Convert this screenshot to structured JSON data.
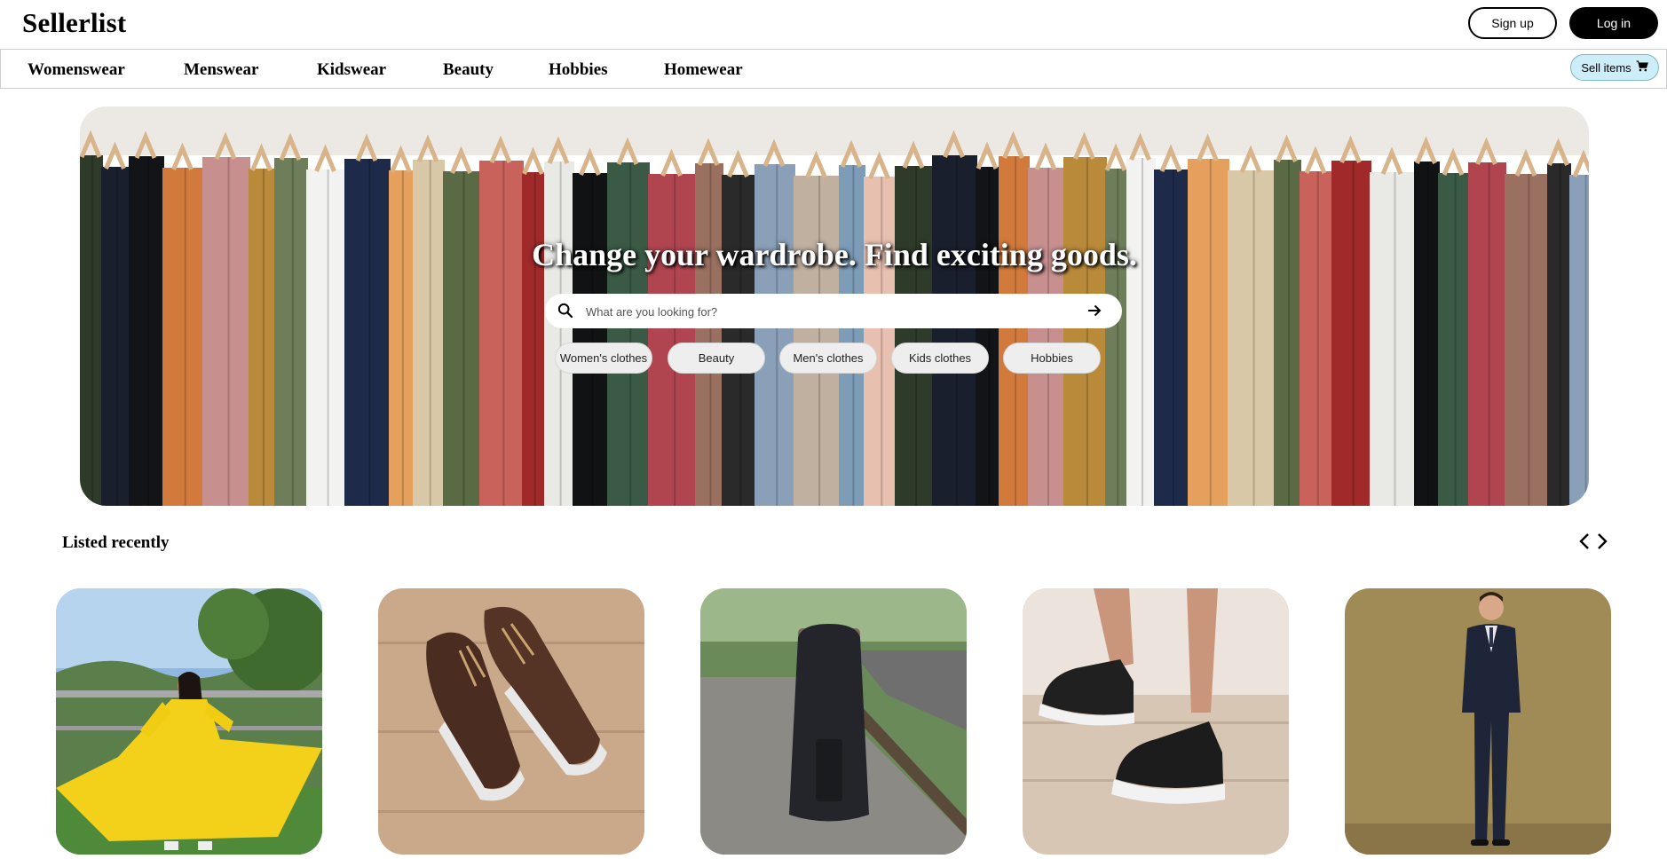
{
  "header": {
    "brand": "Sellerlist",
    "signup_label": "Sign up",
    "login_label": "Log in"
  },
  "nav": {
    "categories": [
      "Womenswear",
      "Menswear",
      "Kidswear",
      "Beauty",
      "Hobbies",
      "Homewear"
    ],
    "sell_label": "Sell items",
    "sell_icon": "cart-icon"
  },
  "hero": {
    "title": "Change your wardrobe. Find exciting goods.",
    "search_placeholder": "What are you looking for?",
    "search_icon": "search-icon",
    "submit_icon": "arrow-right-icon",
    "chips": [
      "Women's clothes",
      "Beauty",
      "Men's clothes",
      "Kids clothes",
      "Hobbies"
    ]
  },
  "listed": {
    "title": "Listed recently",
    "prev_icon": "chevron-left-icon",
    "next_icon": "chevron-right-icon",
    "items": [
      {
        "subject": "yellow-dress"
      },
      {
        "subject": "brown-sneakers"
      },
      {
        "subject": "black-backpack"
      },
      {
        "subject": "black-sneakers"
      },
      {
        "subject": "navy-suit"
      }
    ]
  },
  "colors": {
    "sell_button_bg": "#cdeef8",
    "login_bg": "#000000"
  }
}
